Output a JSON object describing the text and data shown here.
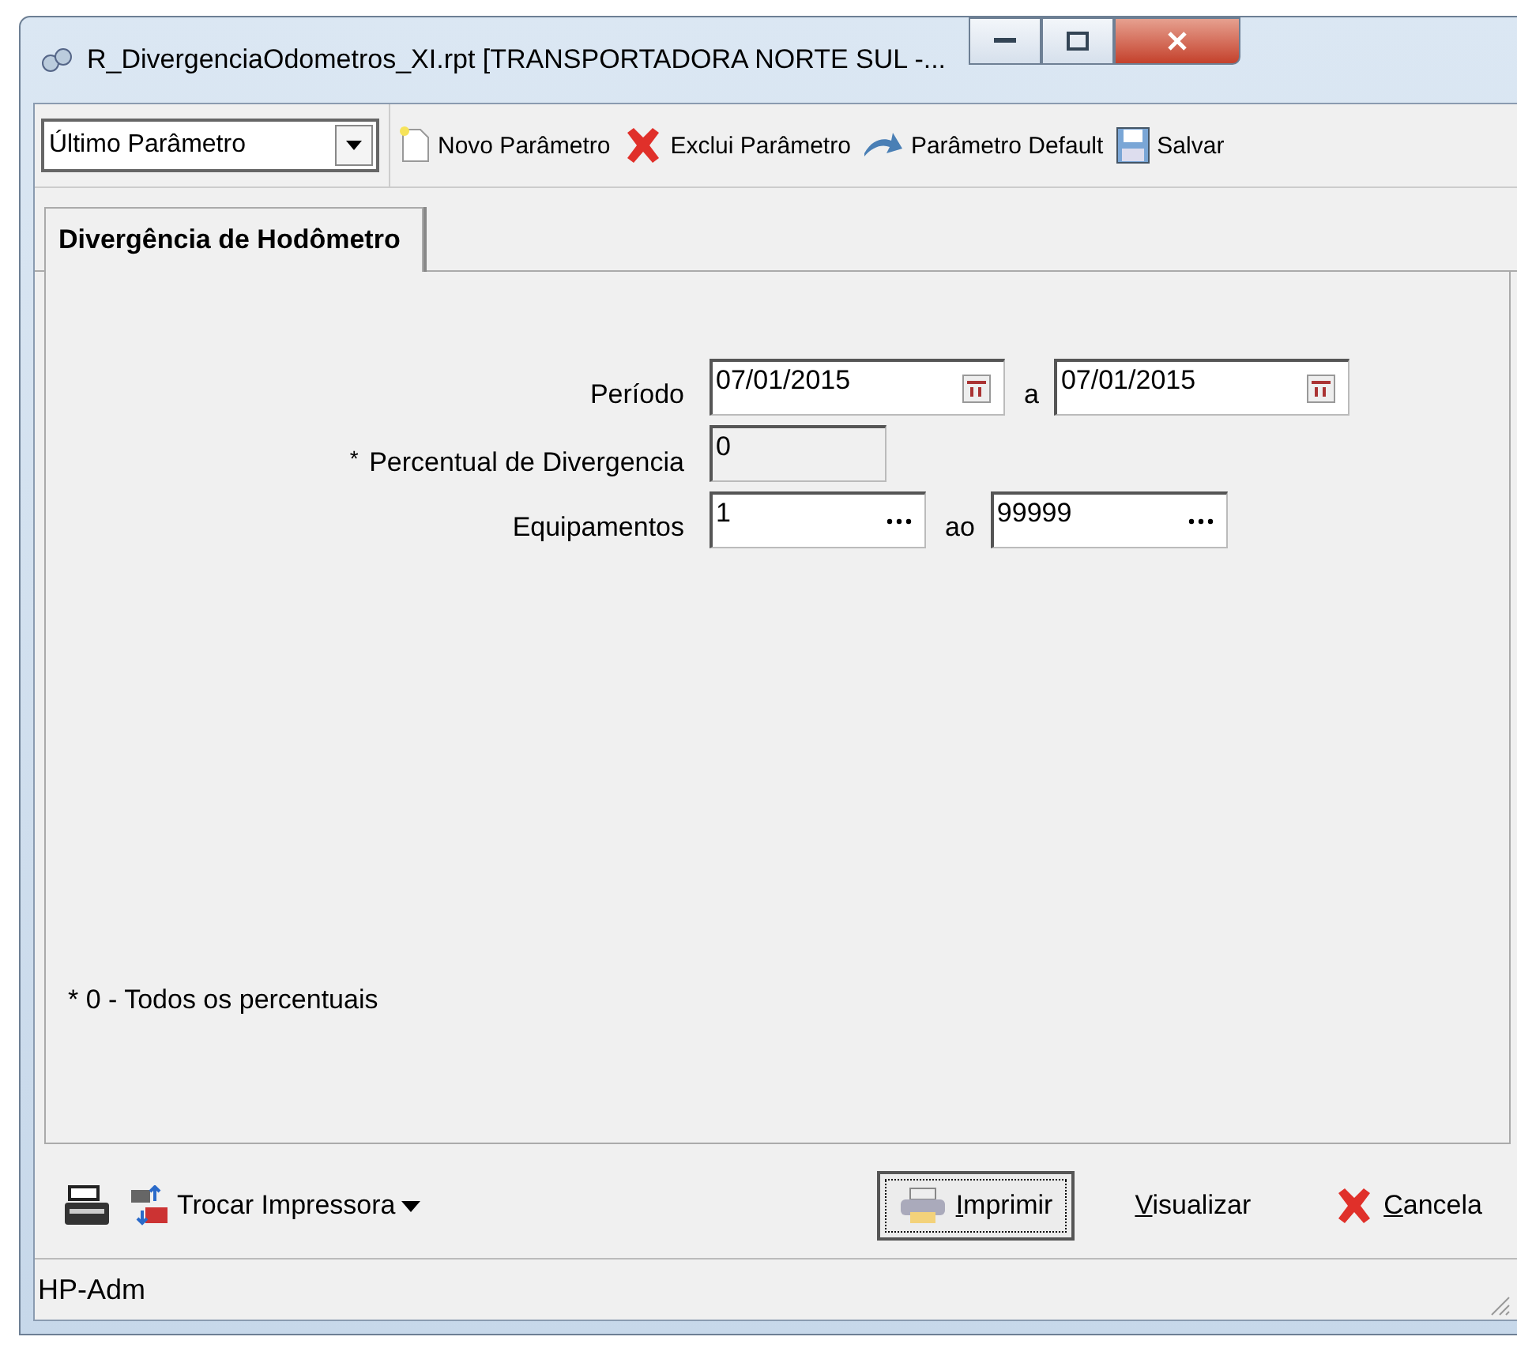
{
  "window": {
    "title": "R_DivergenciaOdometros_XI.rpt [TRANSPORTADORA NORTE SUL -..."
  },
  "toolbar": {
    "parameter_select": {
      "value": "Último Parâmetro"
    },
    "buttons": [
      {
        "label": "Novo Parâmetro",
        "kind": "new"
      },
      {
        "label": "Exclui Parâmetro",
        "kind": "delete"
      },
      {
        "label": "Parâmetro Default",
        "kind": "default"
      },
      {
        "label": "Salvar",
        "kind": "save"
      }
    ]
  },
  "tabs": [
    {
      "label": "Divergência de Hodômetro",
      "selected": true
    }
  ],
  "form": {
    "rows": [
      {
        "label": "Período",
        "kind": "date",
        "from": "07/01/2015",
        "separator": "a",
        "to": "07/01/2015"
      },
      {
        "label": "Percentual de Divergencia",
        "marker": "*",
        "kind": "text",
        "value": "0"
      },
      {
        "label": "Equipamentos",
        "kind": "lookup",
        "from": "1",
        "separator": "ao",
        "to": "99999"
      }
    ]
  },
  "footnote": "* 0 - Todos os percentuais",
  "bottom": {
    "printer_button": "Trocar Impressora",
    "buttons": [
      {
        "label": "Imprimir",
        "kind": "print",
        "default": true
      },
      {
        "label": "Visualizar",
        "kind": "plain",
        "default": false
      },
      {
        "label": "Cancela",
        "kind": "cancel",
        "default": false
      }
    ]
  },
  "status_bar": "HP-Adm"
}
